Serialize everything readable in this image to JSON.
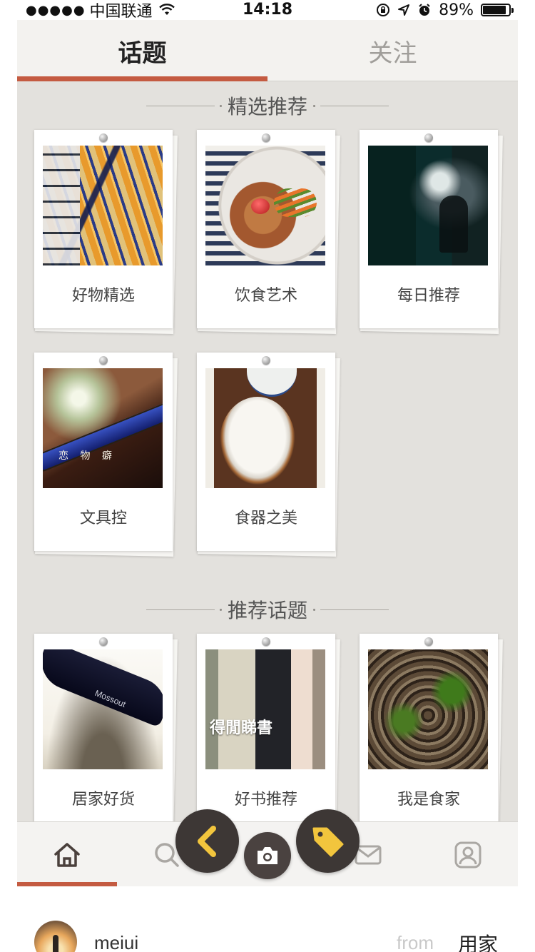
{
  "status_bar": {
    "signal_dots": "●●●●●",
    "carrier": "中国联通",
    "time": "14:18",
    "battery_percent": "89%",
    "battery_level": 0.89,
    "icons": [
      "wifi-icon",
      "rotation-lock-icon",
      "location-icon",
      "alarm-icon",
      "battery-icon"
    ]
  },
  "tabs": [
    {
      "label": "话题",
      "active": true
    },
    {
      "label": "关注",
      "active": false
    }
  ],
  "sections": [
    {
      "title": "精选推荐",
      "cards": [
        {
          "label": "好物精选"
        },
        {
          "label": "饮食艺术"
        },
        {
          "label": "每日推荐"
        },
        {
          "label": "文具控"
        },
        {
          "label": "食器之美"
        }
      ]
    },
    {
      "title": "推荐话题",
      "cards": [
        {
          "label": "居家好货"
        },
        {
          "label": "好书推荐"
        },
        {
          "label": "我是食家"
        }
      ]
    }
  ],
  "photo_texts": {
    "stationery_caption": "恋 物 癖",
    "knife_brand": "Mossout",
    "book_title": "得閒睇書"
  },
  "bottom_nav": {
    "items": [
      "home-icon",
      "search-icon",
      "camera-icon",
      "mail-icon",
      "profile-icon"
    ],
    "active": "home-icon"
  },
  "floating_buttons": [
    "back-chevron-icon",
    "camera-icon",
    "tag-icon"
  ],
  "footer": {
    "username": "meiui",
    "from_label": "from",
    "source": "用家"
  },
  "colors": {
    "accent": "#c45b41",
    "background": "#e3e1dd",
    "fab": "#3d3735",
    "fab_icon": "#f2c53d"
  }
}
